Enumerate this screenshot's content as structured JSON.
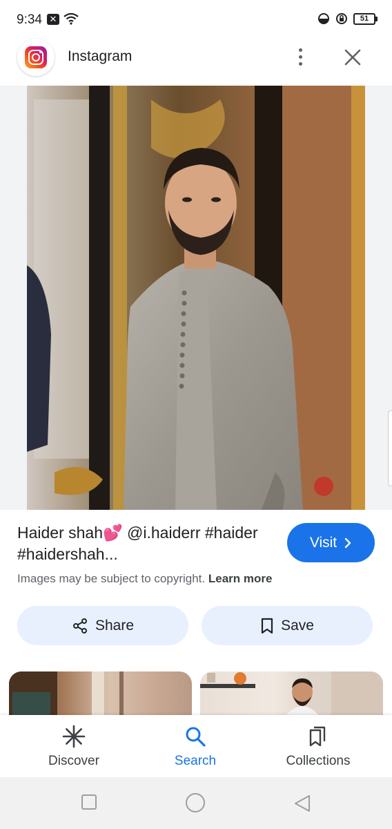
{
  "status_bar": {
    "time": "9:34",
    "notification_icon": "x-box-icon",
    "battery": "51",
    "icons": [
      "wifi-icon",
      "data-saver-icon",
      "vpn-lock-icon",
      "battery-icon"
    ]
  },
  "header": {
    "app_name": "Instagram",
    "app_icon": "instagram-logo",
    "more_icon": "more-vert-icon",
    "close_icon": "close-icon"
  },
  "result": {
    "caption": "Haider shah💕 @i.haiderr #haider #haidershah...",
    "visit_label": "Visit",
    "copyright_text": "Images may be subject to copyright.",
    "learn_more": "Learn more"
  },
  "actions": {
    "share_label": "Share",
    "save_label": "Save"
  },
  "bottom_nav": {
    "items": [
      {
        "label": "Discover",
        "icon": "asterisk-icon"
      },
      {
        "label": "Search",
        "icon": "search-icon",
        "active": true
      },
      {
        "label": "Collections",
        "icon": "collections-icon"
      }
    ]
  },
  "system_nav": {
    "icons": [
      "recents-square-icon",
      "home-circle-icon",
      "back-triangle-icon"
    ]
  },
  "colors": {
    "accent": "#1a73e8",
    "chip_bg": "#e8f0fe",
    "text": "#202124",
    "muted": "#5f6368"
  }
}
